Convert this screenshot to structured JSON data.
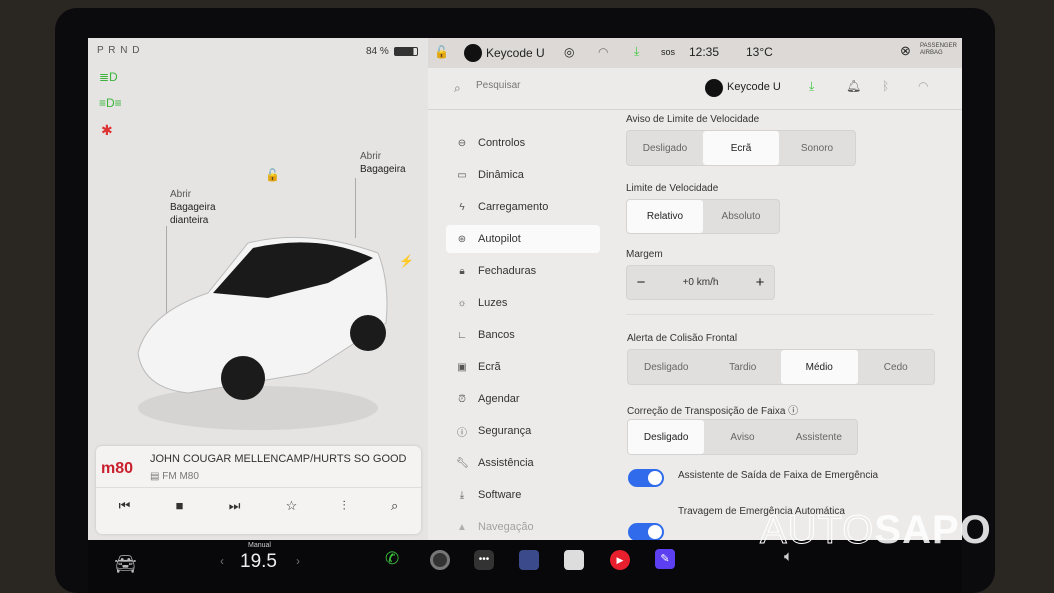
{
  "left_panel": {
    "gear": "P R N D",
    "battery": "84 %",
    "callouts": {
      "frunk": [
        "Abrir",
        "Bagageira",
        "dianteira"
      ],
      "trunk": [
        "Abrir",
        "Bagageira"
      ]
    }
  },
  "status_bar": {
    "profile": "Keycode U",
    "time": "12:35",
    "temperature": "13°C",
    "sos": "sos",
    "airbag": [
      "PASSENGER",
      "AIRBAG"
    ]
  },
  "search": {
    "placeholder": "Pesquisar",
    "profile": "Keycode U"
  },
  "nav": [
    {
      "label": "Controlos",
      "icon": "toggle-icon"
    },
    {
      "label": "Dinâmica",
      "icon": "car-icon"
    },
    {
      "label": "Carregamento",
      "icon": "bolt-icon"
    },
    {
      "label": "Autopilot",
      "icon": "steering-wheel-icon",
      "selected": true
    },
    {
      "label": "Fechaduras",
      "icon": "lock-icon"
    },
    {
      "label": "Luzes",
      "icon": "sun-icon"
    },
    {
      "label": "Bancos",
      "icon": "seat-icon"
    },
    {
      "label": "Ecrã",
      "icon": "screen-icon"
    },
    {
      "label": "Agendar",
      "icon": "clock-icon"
    },
    {
      "label": "Segurança",
      "icon": "alert-icon"
    },
    {
      "label": "Assistência",
      "icon": "wrench-icon"
    },
    {
      "label": "Software",
      "icon": "download-icon"
    },
    {
      "label": "Navegação",
      "icon": "navigation-icon"
    }
  ],
  "settings": {
    "speed_warning": {
      "label": "Aviso de Limite de Velocidade",
      "options": [
        "Desligado",
        "Ecrã",
        "Sonoro"
      ],
      "selected": "Ecrã"
    },
    "speed_limit": {
      "label": "Limite de Velocidade",
      "options": [
        "Relativo",
        "Absoluto"
      ],
      "selected": "Relativo"
    },
    "margin": {
      "label": "Margem",
      "value": "+0 km/h",
      "minus": "−",
      "plus": "+"
    },
    "collision": {
      "label": "Alerta de Colisão Frontal",
      "options": [
        "Desligado",
        "Tardio",
        "Médio",
        "Cedo"
      ],
      "selected": "Médio"
    },
    "lane": {
      "label": "Correção de Transposição de Faixa",
      "options": [
        "Desligado",
        "Aviso",
        "Assistente"
      ],
      "selected": "Desligado"
    },
    "toggles": [
      {
        "label": "Assistente de Saída de Faixa de Emergência",
        "on": true
      },
      {
        "label": "Travagem de Emergência Automática",
        "on": true
      }
    ]
  },
  "media": {
    "logo": "m80",
    "track": "JOHN COUGAR MELLENCAMP/HURTS SO GOOD",
    "station": "FM M80"
  },
  "taskbar": {
    "climate_mode": "Manual",
    "temperature": "19.5"
  },
  "watermark": "AUTOSAPO",
  "colors": {
    "accent": "#2f6bea",
    "green": "#3cc83c"
  }
}
